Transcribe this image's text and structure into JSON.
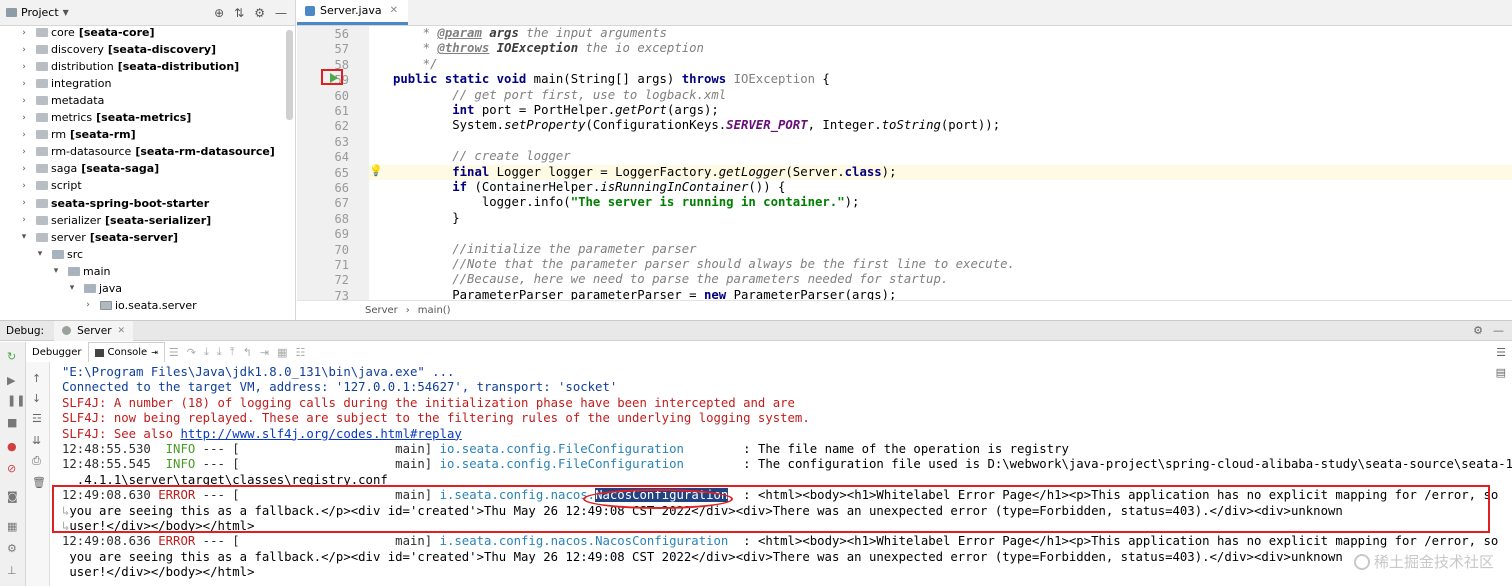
{
  "project": {
    "title": "Project",
    "items": [
      {
        "name": "core",
        "module": "[seata-core]"
      },
      {
        "name": "discovery",
        "module": "[seata-discovery]"
      },
      {
        "name": "distribution",
        "module": "[seata-distribution]"
      },
      {
        "name": "integration",
        "module": ""
      },
      {
        "name": "metadata",
        "module": ""
      },
      {
        "name": "metrics",
        "module": "[seata-metrics]"
      },
      {
        "name": "rm",
        "module": "[seata-rm]"
      },
      {
        "name": "rm-datasource",
        "module": "[seata-rm-datasource]"
      },
      {
        "name": "saga",
        "module": "[seata-saga]"
      },
      {
        "name": "script",
        "module": ""
      },
      {
        "name": "seata-spring-boot-starter",
        "module": ""
      },
      {
        "name": "serializer",
        "module": "[seata-serializer]"
      },
      {
        "name": "server",
        "module": "[seata-server]"
      },
      {
        "name": "src",
        "module": ""
      },
      {
        "name": "main",
        "module": ""
      },
      {
        "name": "java",
        "module": ""
      },
      {
        "name": "io.seata.server",
        "module": ""
      }
    ]
  },
  "editor": {
    "tab_label": "Server.java",
    "line_numbers": [
      "56",
      "57",
      "58",
      "59",
      "60",
      "61",
      "62",
      "63",
      "64",
      "65",
      "66",
      "67",
      "68",
      "69",
      "70",
      "71",
      "72",
      "73"
    ],
    "breadcrumb": [
      "Server",
      "main()"
    ]
  },
  "debug": {
    "title": "Debug:",
    "session": "Server",
    "tabs": {
      "debugger": "Debugger",
      "console": "Console"
    },
    "console": {
      "cmd": "\"E:\\Program Files\\Java\\jdk1.8.0_131\\bin\\java.exe\" ...",
      "connected": "Connected to the target VM, address: '127.0.0.1:54627', transport: 'socket'",
      "slf1": "SLF4J: A number (18) of logging calls during the initialization phase have been intercepted and are",
      "slf2": "SLF4J: now being replayed. These are subject to the filtering rules of the underlying logging system.",
      "slf3_prefix": "SLF4J: See also ",
      "slf3_link": "http://www.slf4j.org/codes.html#replay",
      "log1_time": "12:48:55.530",
      "log1_level": "INFO",
      "log1_mid": " --- [                     main] ",
      "log1_logger": "io.seata.config.FileConfiguration",
      "log1_msg": "        : The file name of the operation is registry",
      "log2_time": "12:48:55.545",
      "log2_level": "INFO",
      "log2_mid": " --- [                     main] ",
      "log2_logger": "io.seata.config.FileConfiguration",
      "log2_msg": "        : The configuration file used is D:\\webwork\\java-project\\spring-cloud-alibaba-study\\seata-source\\seata-1",
      "log2_wrap": "  .4.1.1\\server\\target\\classes\\registry.conf",
      "err1_time": "12:49:08.630",
      "err1_level": "ERROR",
      "err1_mid": " --- [                     main] ",
      "err1_logger_pkg": "i.seata.config.nacos.",
      "err1_logger_cls": "NacosConfiguration",
      "err1_msg": "  : <html><body><h1>Whitelabel Error Page</h1><p>This application has no explicit mapping for /error, so",
      "err1_wrap1": "you are seeing this as a fallback.</p><div id='created'>Thu May 26 12:49:08 CST 2022</div><div>There was an unexpected error (type=Forbidden, status=403).</div><div>unknown",
      "err1_wrap2": "user!</div></body></html>",
      "err2_time": "12:49:08.636",
      "err2_level": "ERROR",
      "err2_mid": " --- [                     main] ",
      "err2_logger": "i.seata.config.nacos.NacosConfiguration",
      "err2_msg": "  : <html><body><h1>Whitelabel Error Page</h1><p>This application has no explicit mapping for /error, so",
      "err2_wrap1": " you are seeing this as a fallback.</p><div id='created'>Thu May 26 12:49:08 CST 2022</div><div>There was an unexpected error (type=Forbidden, status=403).</div><div>unknown",
      "err2_wrap2": " user!</div></body></html>"
    }
  },
  "watermark": "稀土掘金技术社区",
  "colors": {
    "error_box": "#e02020",
    "run_gutter": "#4fa849",
    "selection": "#214283"
  }
}
